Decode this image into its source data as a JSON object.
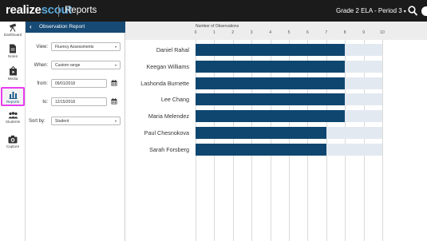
{
  "topbar": {
    "brand_part1": "realize",
    "brand_part2": "scout",
    "app_title": "Reports",
    "class_selector": "Grade 2 ELA - Period 3",
    "chevron": "▾",
    "search_icon": "search-icon",
    "avatar_icon": "user-avatar-icon"
  },
  "rail": {
    "items": [
      {
        "label": "Dashboard",
        "icon": "telescope-icon"
      },
      {
        "label": "Notes",
        "icon": "note-icon"
      },
      {
        "label": "Media",
        "icon": "media-icon"
      },
      {
        "label": "Reports",
        "icon": "bar-chart-icon",
        "active": true
      },
      {
        "label": "Students",
        "icon": "students-icon"
      },
      {
        "label": "Capture",
        "icon": "camera-icon"
      }
    ]
  },
  "panel": {
    "title": "Observation Report",
    "back_icon": "‹",
    "view_label": "View:",
    "view_value": "Fluency Assessments",
    "when_label": "When:",
    "when_value": "Custom range",
    "from_label": "from:",
    "from_value": "09/01/2018",
    "to_label": "to:",
    "to_value": "12/15/2018",
    "sortby_label": "Sort by:",
    "sortby_value": "Student",
    "dropdown_glyph": "▾"
  },
  "chart_data": {
    "type": "bar",
    "orientation": "horizontal",
    "title": "",
    "xlabel": "Number of Observations",
    "xlim": [
      0,
      10
    ],
    "ticks": [
      "0",
      "1",
      "2",
      "3",
      "4",
      "5",
      "6",
      "7",
      "8",
      "9",
      "10"
    ],
    "categories": [
      "Daniel Rahal",
      "Keegan Williams",
      "Lashonda Burnette",
      "Lee Chang",
      "Maria Melendez",
      "Paul Chesnokova",
      "Sarah Forsberg"
    ],
    "values": [
      8,
      8,
      8,
      8,
      8,
      7,
      7
    ],
    "bar_color": "#0f4670",
    "track_color": "#e3e9f0"
  }
}
